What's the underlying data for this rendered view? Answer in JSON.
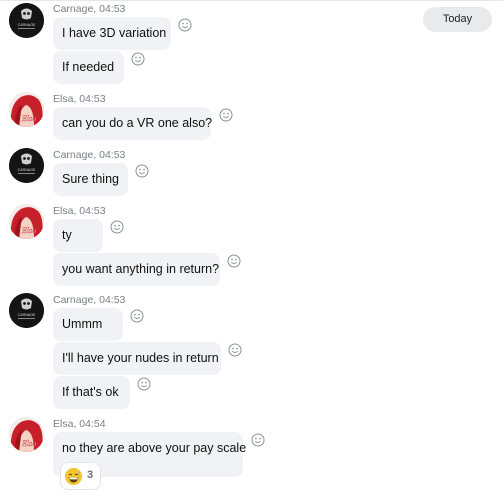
{
  "date_divider": "Today",
  "groups": [
    {
      "sender": "Carnage",
      "time": "04:53",
      "avatar": "carnage-avatar",
      "messages": [
        "I have 3D variation",
        "If needed"
      ]
    },
    {
      "sender": "Elsa",
      "time": "04:53",
      "avatar": "elsa-avatar",
      "messages": [
        "can you do a VR one also?"
      ]
    },
    {
      "sender": "Carnage",
      "time": "04:53",
      "avatar": "carnage-avatar",
      "messages": [
        "Sure thing"
      ]
    },
    {
      "sender": "Elsa",
      "time": "04:53",
      "avatar": "elsa-avatar",
      "messages": [
        "ty",
        "you want anything in return?"
      ]
    },
    {
      "sender": "Carnage",
      "time": "04:53",
      "avatar": "carnage-avatar",
      "messages": [
        "Ummm",
        "I'll have your nudes in return",
        "If that's ok"
      ]
    },
    {
      "sender": "Elsa",
      "time": "04:54",
      "avatar": "elsa-avatar",
      "messages": [
        "no they are above your pay scale"
      ]
    }
  ],
  "reaction": {
    "emoji": "grinning-sweat-face",
    "count": "3"
  },
  "avatar_text": {
    "carnage": "CARNAGE",
    "elsa": "Elsa"
  },
  "icons": {
    "add_reaction": "smiley-face-icon"
  },
  "colors": {
    "bubble": "#f0f2f5",
    "meta": "#7a7f86",
    "pill": "#e9eaec"
  }
}
